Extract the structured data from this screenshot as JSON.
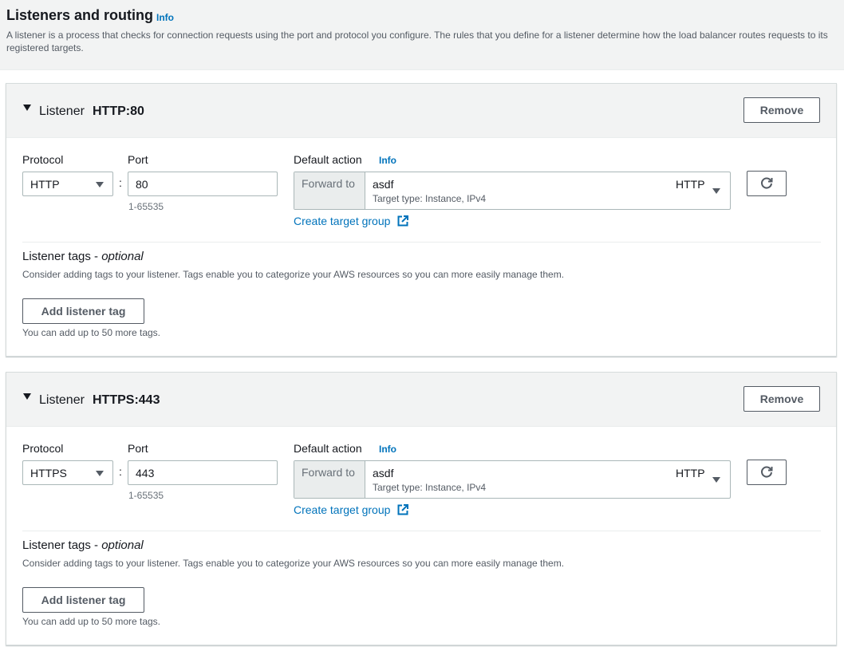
{
  "header": {
    "title": "Listeners and routing",
    "info_label": "Info",
    "description": "A listener is a process that checks for connection requests using the port and protocol you configure. The rules that you define for a listener determine how the load balancer routes requests to its registered targets."
  },
  "listeners": [
    {
      "label": "Listener",
      "name": "HTTP:80",
      "remove_label": "Remove",
      "protocol_label": "Protocol",
      "protocol_value": "HTTP",
      "port_label": "Port",
      "port_value": "80",
      "port_hint": "1-65535",
      "action_label": "Default action",
      "action_info": "Info",
      "forward_prefix": "Forward to",
      "target_group": "asdf",
      "target_desc": "Target type: Instance, IPv4",
      "target_protocol": "HTTP",
      "create_link": "Create target group",
      "tags_title": "Listener tags - ",
      "tags_optional": "optional",
      "tags_desc": "Consider adding tags to your listener. Tags enable you to categorize your AWS resources so you can more easily manage them.",
      "add_tag_label": "Add listener tag",
      "tags_hint": "You can add up to 50 more tags."
    },
    {
      "label": "Listener",
      "name": "HTTPS:443",
      "remove_label": "Remove",
      "protocol_label": "Protocol",
      "protocol_value": "HTTPS",
      "port_label": "Port",
      "port_value": "443",
      "port_hint": "1-65535",
      "action_label": "Default action",
      "action_info": "Info",
      "forward_prefix": "Forward to",
      "target_group": "asdf",
      "target_desc": "Target type: Instance, IPv4",
      "target_protocol": "HTTP",
      "create_link": "Create target group",
      "tags_title": "Listener tags - ",
      "tags_optional": "optional",
      "tags_desc": "Consider adding tags to your listener. Tags enable you to categorize your AWS resources so you can more easily manage them.",
      "add_tag_label": "Add listener tag",
      "tags_hint": "You can add up to 50 more tags."
    }
  ],
  "icons": {
    "expand": "caret-down-icon",
    "dropdown": "triangle-down-icon",
    "refresh": "refresh-icon",
    "external": "external-link-icon"
  },
  "colors": {
    "link": "#0073bb",
    "header_bg": "#f2f3f3",
    "text": "#16191f",
    "muted": "#545b64"
  }
}
